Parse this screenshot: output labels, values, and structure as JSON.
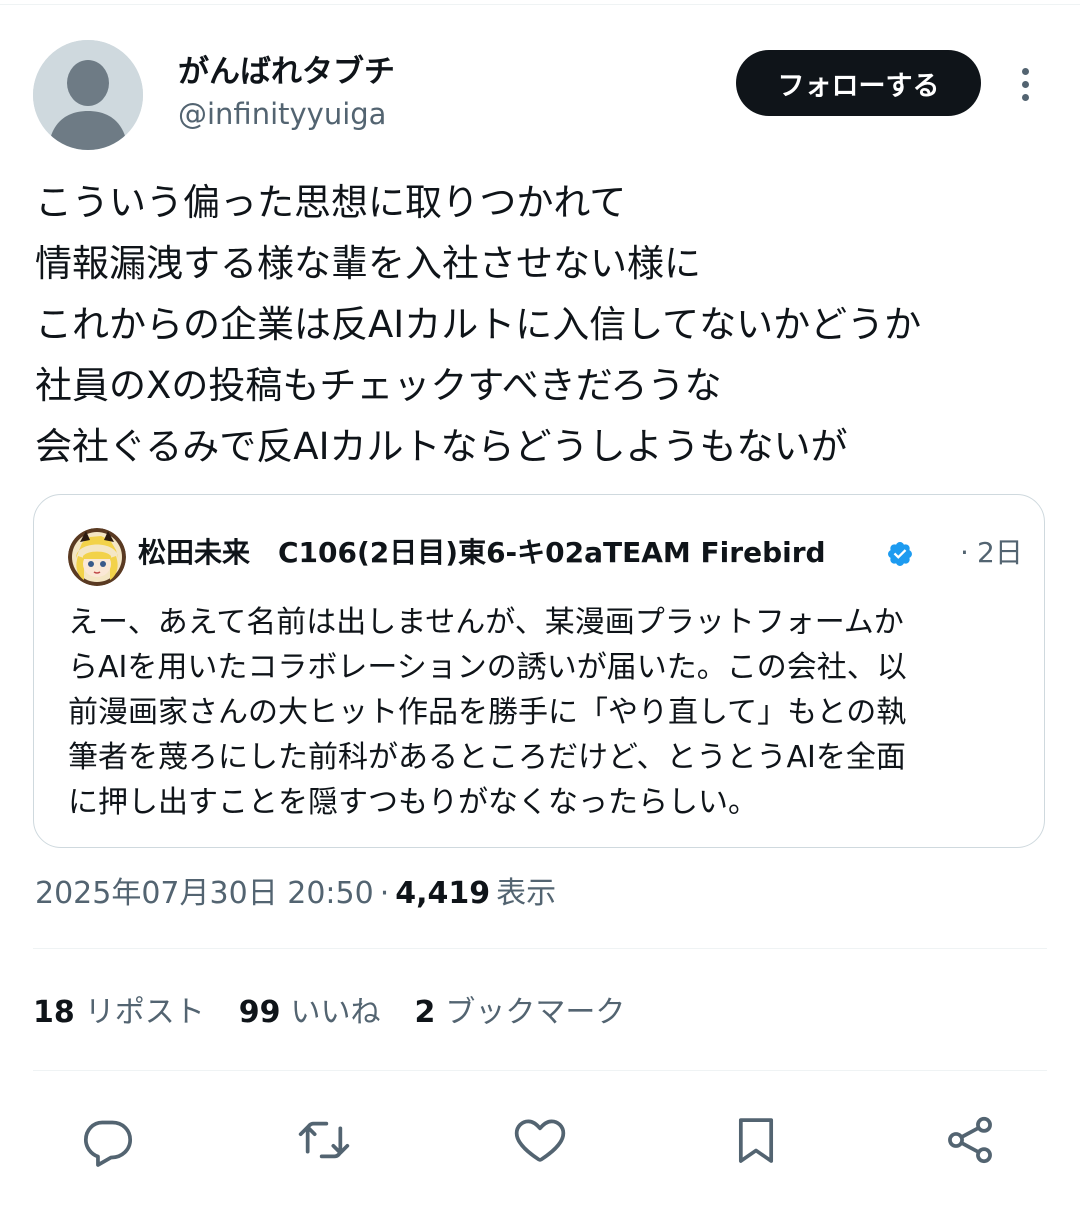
{
  "author": {
    "display_name": "がんばれタブチ",
    "handle": "@infinityyuiga"
  },
  "header": {
    "follow_label": "フォローする",
    "more_icon": "more-vertical-icon"
  },
  "tweet": {
    "lines": [
      "こういう偏った思想に取りつかれて",
      "情報漏洩する様な輩を入社させない様に",
      "これからの企業は反AIカルトに入信してないかどうか",
      "社員のXの投稿もチェックすべきだろうな",
      "会社ぐるみで反AIカルトならどうしようもないが"
    ]
  },
  "quote": {
    "display_name": "松田未来　C106(2日目)東6-キ02aTEAM Firebird",
    "verified": true,
    "separator": "·",
    "time": "2日",
    "lines": [
      "えー、あえて名前は出しませんが、某漫画プラットフォームか",
      "らAIを用いたコラボレーションの誘いが届いた。この会社、以",
      "前漫画家さんの大ヒット作品を勝手に「やり直して」もとの執",
      "筆者を蔑ろにした前科があるところだけど、とうとうAIを全面",
      "に押し出すことを隠すつもりがなくなったらしい。"
    ]
  },
  "meta": {
    "timestamp": "2025年07月30日 20:50",
    "separator": "·",
    "views": "4,419",
    "views_label": "表示"
  },
  "stats": {
    "reposts": {
      "count": "18",
      "label": "リポスト"
    },
    "likes": {
      "count": "99",
      "label": "いいね"
    },
    "bookmarks": {
      "count": "2",
      "label": "ブックマーク"
    }
  },
  "actions": [
    "reply-icon",
    "repost-icon",
    "like-icon",
    "bookmark-icon",
    "share-icon"
  ],
  "colors": {
    "text_primary": "#0f1419",
    "text_secondary": "#536471",
    "border": "#cfd9de",
    "verified_blue": "#1d9bf0",
    "follow_bg": "#0f1419"
  }
}
